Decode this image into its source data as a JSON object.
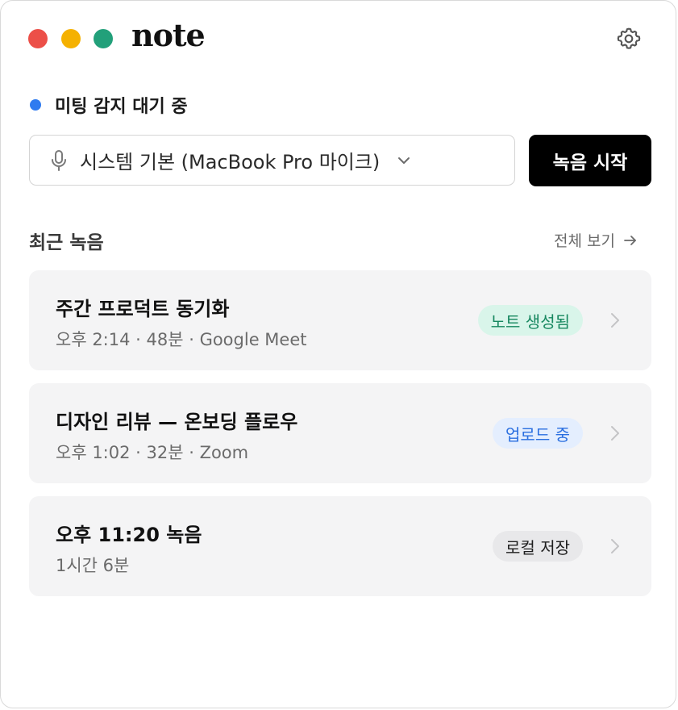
{
  "app": {
    "logo_text": "note",
    "window_controls": [
      "close",
      "minimize",
      "zoom"
    ],
    "settings_icon": "gear-icon"
  },
  "status": {
    "text": "미팅 감지 대기 중",
    "dot_color": "#2f7bf0"
  },
  "audio_input": {
    "selected": "시스템 기본 (MacBook Pro 마이크)",
    "icon": "microphone-icon"
  },
  "record_button": {
    "label": "녹음 시작"
  },
  "recent": {
    "title": "최근 녹음",
    "view_all_label": "전체 보기",
    "items": [
      {
        "title": "주간 프로덕트 동기화",
        "meta": "오후 2:14 · 48분 · Google Meet",
        "badge": "노트 생성됨",
        "badge_color": "#16875f"
      },
      {
        "title": "디자인 리뷰 — 온보딩 플로우",
        "meta": "오후 1:02 · 32분 · Zoom",
        "badge": "업로드 중",
        "badge_color": "#2a6fe0"
      },
      {
        "title": "오후 11:20 녹음",
        "meta": "1시간 6분",
        "badge": "로컬 저장",
        "badge_color": "#1f1f1f"
      }
    ]
  }
}
